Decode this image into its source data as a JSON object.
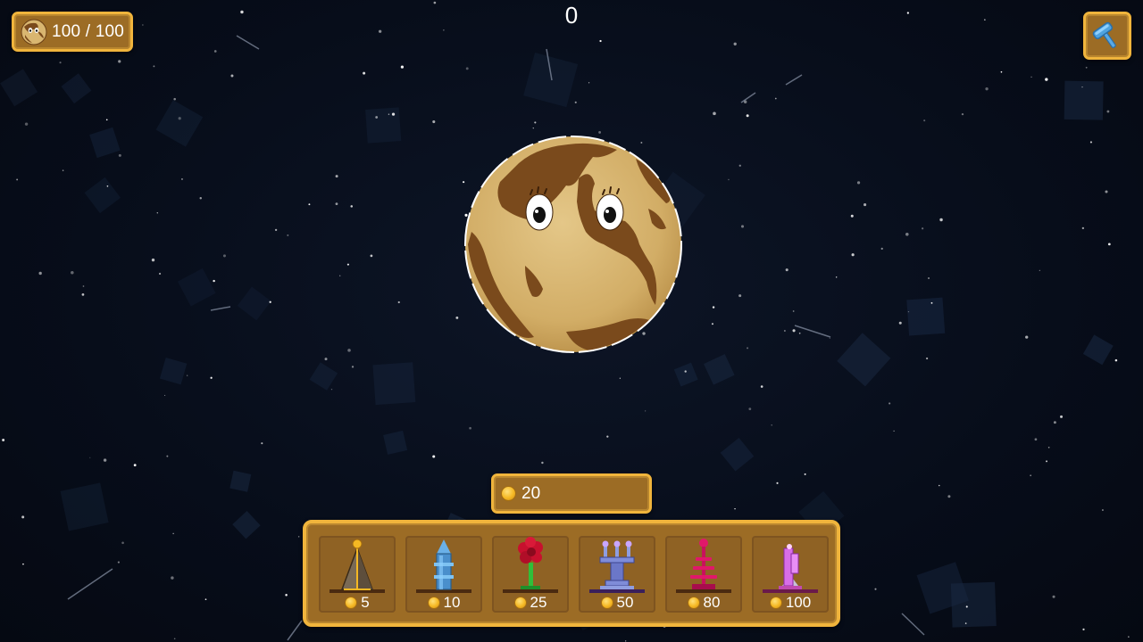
{
  "hud": {
    "health_text": "100 / 100",
    "health_current": 100,
    "health_max": 100,
    "score": "0",
    "coins": "20"
  },
  "icons": {
    "health": "planet-face-icon",
    "build": "hammer-icon",
    "currency": "coin-icon"
  },
  "shop": {
    "items": [
      {
        "icon": "pyramid-tower-icon",
        "price": "5"
      },
      {
        "icon": "blue-rocket-tower-icon",
        "price": "10"
      },
      {
        "icon": "flower-tower-icon",
        "price": "25"
      },
      {
        "icon": "triple-turret-tower-icon",
        "price": "50"
      },
      {
        "icon": "tesla-coil-tower-icon",
        "price": "80"
      },
      {
        "icon": "crystal-tower-icon",
        "price": "100"
      }
    ]
  },
  "colors": {
    "panel_fill": "#9c6c25",
    "panel_border": "#f0b43c",
    "space": "#070d1a",
    "planet_land": "#7a4a1c",
    "planet_sea": "#d9b670",
    "coin": "#f5b823"
  }
}
